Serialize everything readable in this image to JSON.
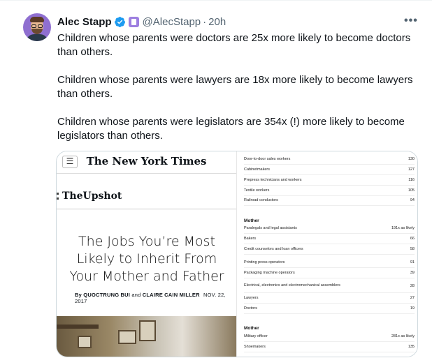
{
  "tweet": {
    "author_name": "Alec Stapp",
    "handle": "@AlecStapp",
    "separator": "·",
    "time": "20h",
    "more_icon": "•••",
    "paragraphs": [
      "Children whose parents were doctors are 25x more likely to become doctors than others.",
      "Children whose parents were lawyers are 18x more likely to become lawyers than others.",
      "Children whose parents were legislators are 354x (!) more likely to become legislators than others."
    ]
  },
  "article": {
    "menu_icon": "☰",
    "masthead": "The New York Times",
    "section": "TheUpshot",
    "headline": "The Jobs You’re Most Likely to Inherit From Your Mother and Father",
    "byline_prefix": "By",
    "author1": "QUOCTRUNG BUI",
    "and": "and",
    "author2": "CLAIRE CAIN MILLER",
    "date": "NOV. 22, 2017"
  },
  "table": {
    "top_rows": [
      {
        "label": "Door-to-door sales workers",
        "value": "130"
      },
      {
        "label": "Cabinetmakers",
        "value": "127"
      },
      {
        "label": "Prepress technicians and workers",
        "value": "116"
      },
      {
        "label": "Textile workers",
        "value": "105"
      },
      {
        "label": "Railroad conductors",
        "value": "94"
      }
    ],
    "section1_title": "Mother",
    "section1_rows": [
      {
        "label": "Paralegals and legal assistants",
        "value": "191x as likely"
      },
      {
        "label": "Bakers",
        "value": "66"
      },
      {
        "label": "Credit counselors and loan officers",
        "value": "58"
      },
      {
        "label": "Printing press operators",
        "value": "91"
      },
      {
        "label": "Packaging machine operators",
        "value": "39"
      },
      {
        "label": "Electrical, electronics and electromechanical assemblers",
        "value": "28"
      },
      {
        "label": "Lawyers",
        "value": "27"
      },
      {
        "label": "Doctors",
        "value": "19"
      }
    ],
    "section2_title": "Mother",
    "section2_rows": [
      {
        "label": "Military officer",
        "value": "281x as likely"
      },
      {
        "label": "Shoemakers",
        "value": "135"
      }
    ]
  }
}
